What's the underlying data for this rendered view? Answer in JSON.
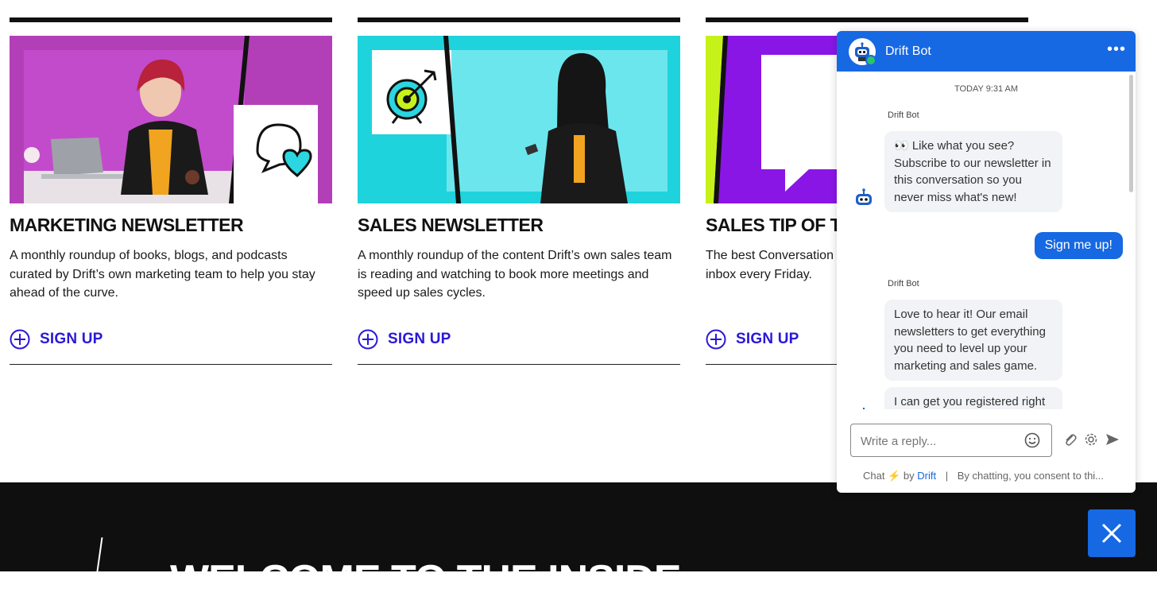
{
  "cards": [
    {
      "title": "MARKETING NEWSLETTER",
      "desc": "A monthly roundup of books, blogs, and podcasts curated by Drift’s own marketing team to help you stay ahead of the curve.",
      "signup": "SIGN UP"
    },
    {
      "title": "SALES NEWSLETTER",
      "desc": "A monthly roundup of the content Drift’s own sales team is reading and watching to book more meetings and speed up sales cycles.",
      "signup": "SIGN UP"
    },
    {
      "title": "SALES TIP OF T",
      "desc": "The best Conversation inbox every Friday.",
      "signup": "SIGN UP"
    }
  ],
  "footer": {
    "headline": "WELCOME TO THE INSIDE"
  },
  "chat": {
    "header_title": "Drift Bot",
    "timestamp": "TODAY 9:31 AM",
    "messages": [
      {
        "sender": "Drift Bot",
        "text": "👀 Like what you see? Subscribe to our newsletter in this conversation so you never miss what's new!"
      },
      {
        "user_reply": "Sign me up!"
      },
      {
        "sender": "Drift Bot",
        "text": "Love to hear it! Our email newsletters to get everything you need to level up your marketing and sales game."
      },
      {
        "text": "I can get you registered right in"
      }
    ],
    "input_placeholder": "Write a reply...",
    "powered_prefix": "Chat",
    "powered_by": "by",
    "powered_brand": "Drift",
    "separator": "|",
    "consent": "By chatting, you consent to thi..."
  },
  "colors": {
    "accent": "#1668e3",
    "signup": "#2a18d8",
    "magenta": "#b33fb8",
    "cyan": "#1fd3dc",
    "purple": "#8a16e6",
    "lime": "#c6f21a"
  },
  "icons": {
    "signup": "plus-circle-icon",
    "chat_close": "close-icon",
    "send": "send-icon",
    "attach": "paperclip-icon",
    "settings": "gear-icon",
    "emoji": "smiley-icon"
  }
}
